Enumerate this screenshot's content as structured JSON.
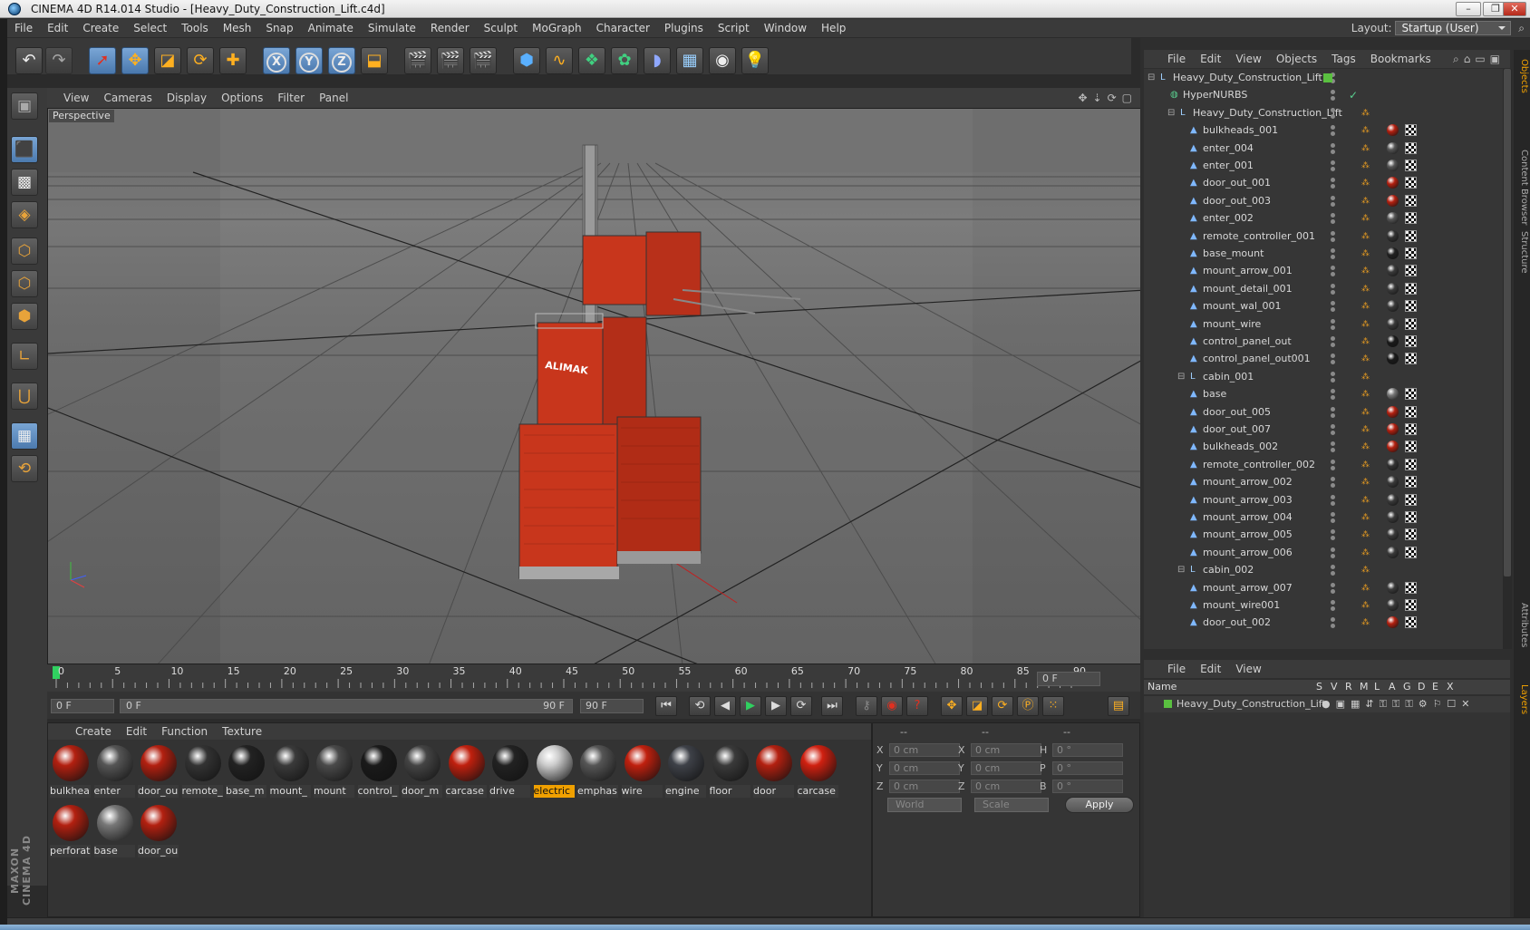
{
  "window": {
    "title": "CINEMA 4D R14.014 Studio - [Heavy_Duty_Construction_Lift.c4d]",
    "controls": [
      "–",
      "❐",
      "✕"
    ]
  },
  "menubar": {
    "items": [
      "File",
      "Edit",
      "Create",
      "Select",
      "Tools",
      "Mesh",
      "Snap",
      "Animate",
      "Simulate",
      "Render",
      "Sculpt",
      "MoGraph",
      "Character",
      "Plugins",
      "Script",
      "Window",
      "Help"
    ],
    "layout_label": "Layout:",
    "layout_value": "Startup (User)"
  },
  "viewport": {
    "menu": [
      "View",
      "Cameras",
      "Display",
      "Options",
      "Filter",
      "Panel"
    ],
    "label": "Perspective",
    "brand_text": "ALIMAK"
  },
  "timeline": {
    "ticks": [
      "0",
      "5",
      "10",
      "15",
      "20",
      "25",
      "30",
      "35",
      "40",
      "45",
      "50",
      "55",
      "60",
      "65",
      "70",
      "75",
      "80",
      "85",
      "90"
    ],
    "frame_field": "0 F",
    "progress": 0.0
  },
  "playback": {
    "start_field": "0 F",
    "slider_start": "0 F",
    "slider_end": "90 F",
    "end_field": "90 F"
  },
  "materials": {
    "menu": [
      "Create",
      "Edit",
      "Function",
      "Texture"
    ],
    "items": [
      {
        "label": "bulkhea",
        "color": "#b32010"
      },
      {
        "label": "enter",
        "color": "#555555"
      },
      {
        "label": "door_ou",
        "color": "#b32010"
      },
      {
        "label": "remote_",
        "color": "#333333"
      },
      {
        "label": "base_m",
        "color": "#222222"
      },
      {
        "label": "mount_",
        "color": "#3a3a3a"
      },
      {
        "label": "mount",
        "color": "#4a4a4a"
      },
      {
        "label": "control_",
        "color": "#1a1a1a"
      },
      {
        "label": "door_m",
        "color": "#444444"
      },
      {
        "label": "carcase",
        "color": "#c0200e"
      },
      {
        "label": "drive",
        "color": "#222222"
      },
      {
        "label": "electric",
        "color": "#cccccc"
      },
      {
        "label": "emphas",
        "color": "#555555"
      },
      {
        "label": "wire",
        "color": "#c0200e"
      },
      {
        "label": "engine",
        "color": "#3e4148"
      },
      {
        "label": "floor",
        "color": "#3a3a3a"
      },
      {
        "label": "door",
        "color": "#b32010"
      },
      {
        "label": "carcase",
        "color": "#d02010"
      },
      {
        "label": "perforat",
        "color": "#b32010"
      },
      {
        "label": "base",
        "color": "#777777"
      },
      {
        "label": "door_ou",
        "color": "#b32010"
      }
    ],
    "selected_index": 11
  },
  "attributes": {
    "headers": [
      "--",
      "--",
      "--"
    ],
    "rows": [
      {
        "a": "X",
        "av": "0 cm",
        "b": "X",
        "bv": "0 cm",
        "c": "H",
        "cv": "0 °"
      },
      {
        "a": "Y",
        "av": "0 cm",
        "b": "Y",
        "bv": "0 cm",
        "c": "P",
        "cv": "0 °"
      },
      {
        "a": "Z",
        "av": "0 cm",
        "b": "Z",
        "bv": "0 cm",
        "c": "B",
        "cv": "0 °"
      }
    ],
    "coord_mode": "World",
    "scale_mode": "Scale",
    "apply": "Apply"
  },
  "objects": {
    "menu": [
      "File",
      "Edit",
      "View",
      "Objects",
      "Tags",
      "Bookmarks"
    ],
    "rows": [
      {
        "name": "Heavy_Duty_Construction_Lift",
        "depth": 0,
        "type": "null",
        "tags": false,
        "root": true
      },
      {
        "name": "HyperNURBS",
        "depth": 1,
        "type": "nurbs",
        "tags": false
      },
      {
        "name": "Heavy_Duty_Construction_Lift",
        "depth": 2,
        "type": "null",
        "tags": false
      },
      {
        "name": "bulkheads_001",
        "depth": 3,
        "type": "poly",
        "mat": "#b32010"
      },
      {
        "name": "enter_004",
        "depth": 3,
        "type": "poly",
        "mat": "#555555"
      },
      {
        "name": "enter_001",
        "depth": 3,
        "type": "poly",
        "mat": "#555555"
      },
      {
        "name": "door_out_001",
        "depth": 3,
        "type": "poly",
        "mat": "#b32010"
      },
      {
        "name": "door_out_003",
        "depth": 3,
        "type": "poly",
        "mat": "#b32010"
      },
      {
        "name": "enter_002",
        "depth": 3,
        "type": "poly",
        "mat": "#555555"
      },
      {
        "name": "remote_controller_001",
        "depth": 3,
        "type": "poly",
        "mat": "#333333"
      },
      {
        "name": "base_mount",
        "depth": 3,
        "type": "poly",
        "mat": "#222222"
      },
      {
        "name": "mount_arrow_001",
        "depth": 3,
        "type": "poly",
        "mat": "#3a3a3a"
      },
      {
        "name": "mount_detail_001",
        "depth": 3,
        "type": "poly",
        "mat": "#3a3a3a"
      },
      {
        "name": "mount_wal_001",
        "depth": 3,
        "type": "poly",
        "mat": "#3a3a3a"
      },
      {
        "name": "mount_wire",
        "depth": 3,
        "type": "poly",
        "mat": "#3a3a3a"
      },
      {
        "name": "control_panel_out",
        "depth": 3,
        "type": "poly",
        "mat": "#1a1a1a"
      },
      {
        "name": "control_panel_out001",
        "depth": 3,
        "type": "poly",
        "mat": "#1a1a1a"
      },
      {
        "name": "cabin_001",
        "depth": 3,
        "type": "null",
        "tags": false
      },
      {
        "name": "base",
        "depth": 3,
        "type": "poly",
        "mat": "#777777"
      },
      {
        "name": "door_out_005",
        "depth": 3,
        "type": "poly",
        "mat": "#b32010"
      },
      {
        "name": "door_out_007",
        "depth": 3,
        "type": "poly",
        "mat": "#b32010"
      },
      {
        "name": "bulkheads_002",
        "depth": 3,
        "type": "poly",
        "mat": "#b32010"
      },
      {
        "name": "remote_controller_002",
        "depth": 3,
        "type": "poly",
        "mat": "#333333"
      },
      {
        "name": "mount_arrow_002",
        "depth": 3,
        "type": "poly",
        "mat": "#3a3a3a"
      },
      {
        "name": "mount_arrow_003",
        "depth": 3,
        "type": "poly",
        "mat": "#3a3a3a"
      },
      {
        "name": "mount_arrow_004",
        "depth": 3,
        "type": "poly",
        "mat": "#3a3a3a"
      },
      {
        "name": "mount_arrow_005",
        "depth": 3,
        "type": "poly",
        "mat": "#3a3a3a"
      },
      {
        "name": "mount_arrow_006",
        "depth": 3,
        "type": "poly",
        "mat": "#3a3a3a"
      },
      {
        "name": "cabin_002",
        "depth": 3,
        "type": "null",
        "tags": false
      },
      {
        "name": "mount_arrow_007",
        "depth": 3,
        "type": "poly",
        "mat": "#3a3a3a"
      },
      {
        "name": "mount_wire001",
        "depth": 3,
        "type": "poly",
        "mat": "#3a3a3a"
      },
      {
        "name": "door_out_002",
        "depth": 3,
        "type": "poly",
        "mat": "#b32010"
      }
    ]
  },
  "layers": {
    "menu": [
      "File",
      "Edit",
      "View"
    ],
    "columns": [
      "Name",
      "S",
      "V",
      "R",
      "M",
      "L",
      "A",
      "G",
      "D",
      "E",
      "X"
    ],
    "row_name": "Heavy_Duty_Construction_Lift"
  },
  "side_tabs": [
    "Objects",
    "Content Browser",
    "Structure",
    "Attributes",
    "Layers"
  ],
  "brand": "MAXON CINEMA 4D",
  "colors": {
    "accent": "#f0a000",
    "lift_red": "#c8361c",
    "selection_blue": "#5a86bb"
  }
}
